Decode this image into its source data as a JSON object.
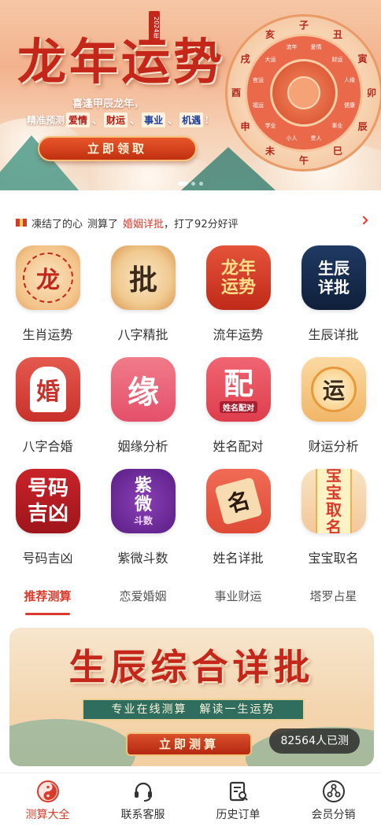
{
  "banner": {
    "title": "龙年运势",
    "year_tag": "2024年",
    "subtitle": "喜逢甲辰龙年，",
    "tagline_prefix": "精准预测",
    "tagline_tags": [
      "爱情",
      "财运",
      "事业",
      "机遇"
    ],
    "tagline_suffix": "!",
    "button": "立即领取",
    "wheel_branches": [
      "子",
      "丑",
      "寅",
      "卯",
      "辰",
      "巳",
      "午",
      "未",
      "申",
      "酉",
      "戌",
      "亥"
    ],
    "wheel_inner": [
      "爱情",
      "财运",
      "人缘",
      "健康",
      "事业",
      "贵人",
      "小人",
      "学业",
      "福运",
      "官运",
      "大运",
      "流年"
    ]
  },
  "notice": {
    "user": "凍结了的心",
    "action": "测算了",
    "item": "婚姻详批",
    "result": "，打了92分好评"
  },
  "services": [
    {
      "label": "生肖运势",
      "icon_text": "龙",
      "icon": "zodiac-wheel-icon"
    },
    {
      "label": "八字精批",
      "icon_text": "批",
      "icon": "bazi-icon"
    },
    {
      "label": "流年运势",
      "icon_text": "龙年运势",
      "icon": "dragon-year-icon"
    },
    {
      "label": "生辰详批",
      "icon_text": "生辰详批",
      "icon": "taiji-icon"
    },
    {
      "label": "八字合婚",
      "icon_text": "婚",
      "icon": "wedding-dress-icon"
    },
    {
      "label": "姻缘分析",
      "icon_text": "缘",
      "icon": "marriage-icon"
    },
    {
      "label": "姓名配对",
      "icon_text": "配",
      "icon_sub": "姓名配对",
      "icon": "name-match-icon"
    },
    {
      "label": "财运分析",
      "icon_text": "运",
      "icon": "coin-icon"
    },
    {
      "label": "号码吉凶",
      "icon_text": "号码吉凶",
      "icon": "number-icon"
    },
    {
      "label": "紫微斗数",
      "icon_text": "紫微",
      "icon_sub": "斗数",
      "icon": "ziwei-icon"
    },
    {
      "label": "姓名详批",
      "icon_text": "名",
      "icon": "scroll-icon"
    },
    {
      "label": "宝宝取名",
      "icon_text": "宝宝取名",
      "icon": "baby-tiger-icon"
    }
  ],
  "tabs": [
    "推荐测算",
    "恋爱婚姻",
    "事业财运",
    "塔罗占星"
  ],
  "active_tab": 0,
  "promo": {
    "title": "生辰综合详批",
    "subtitle": "专业在线测算　解读一生运势",
    "button": "立即测算",
    "count": "82564人已测"
  },
  "nav": [
    {
      "label": "测算大全",
      "icon": "yin-yang-icon",
      "active": true
    },
    {
      "label": "联系客服",
      "icon": "headset-icon",
      "active": false
    },
    {
      "label": "历史订单",
      "icon": "order-search-icon",
      "active": false
    },
    {
      "label": "会员分销",
      "icon": "share-network-icon",
      "active": false
    }
  ],
  "colors": {
    "accent": "#d93a2b",
    "banner_red": "#c4261a",
    "gold": "#f0c27a",
    "jade": "#2f6d5e"
  }
}
